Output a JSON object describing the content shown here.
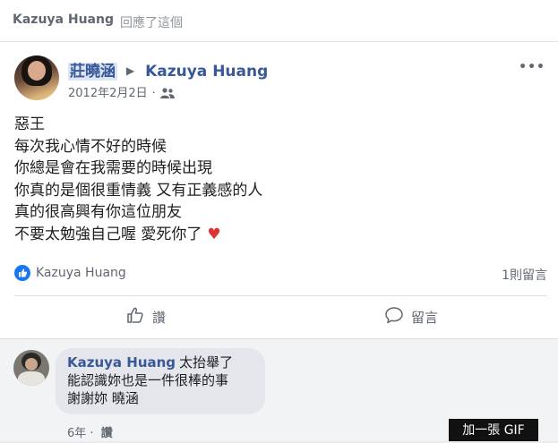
{
  "header": {
    "replier_name": "Kazuya Huang",
    "action_text": "回應了這個"
  },
  "post": {
    "from_name": "莊曉涵",
    "to_name": "Kazuya Huang",
    "date": "2012年2月2日",
    "privacy_icon": "friends-icon",
    "more_icon": "•••",
    "lines": [
      "惡王",
      "每次我心情不好的時候",
      "你總是會在我需要的時候出現",
      "你真的是個很重情義 又有正義感的人",
      "真的很高興有你這位朋友",
      "不要太勉強自己喔 愛死你了"
    ],
    "heart": "♥",
    "liked_by": "Kazuya Huang",
    "comment_count": "1則留言",
    "like_label": "讚",
    "comment_label": "留言"
  },
  "comment": {
    "author": "Kazuya Huang",
    "lines": [
      "太抬舉了",
      "能認識妳也是一件很棒的事",
      "謝謝妳 曉涵"
    ],
    "age": "6年",
    "like_link": "讚",
    "gif_button": "加一張 GIF"
  },
  "colors": {
    "link_blue": "#385898",
    "like_blue": "#1877f2",
    "heart_red": "#e0322e",
    "muted": "#606770"
  }
}
